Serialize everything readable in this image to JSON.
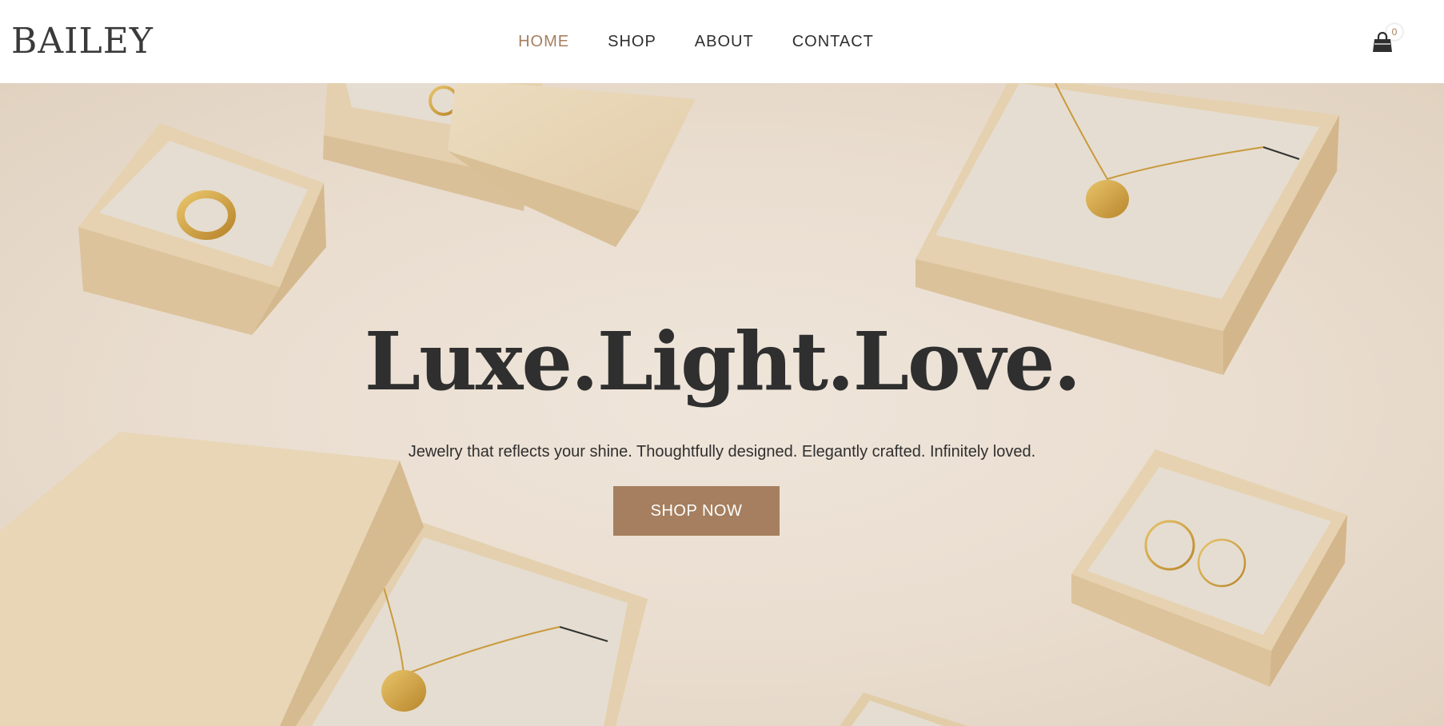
{
  "header": {
    "logo": "BAILEY",
    "nav": [
      {
        "label": "HOME",
        "active": true
      },
      {
        "label": "SHOP",
        "active": false
      },
      {
        "label": "ABOUT",
        "active": false
      },
      {
        "label": "CONTACT",
        "active": false
      }
    ],
    "cart_count": "0",
    "icons": {
      "cart": "shopping-bag-icon"
    }
  },
  "hero": {
    "title": "Luxe.Light.Love.",
    "subtitle": "Jewelry that reflects your shine. Thoughtfully designed. Elegantly crafted. Infinitely loved.",
    "cta_label": "SHOP NOW"
  },
  "colors": {
    "accent": "#a57f5f",
    "text": "#2f2f2f",
    "background": "#ffffff",
    "hero_background": "#ebe0d3",
    "box": "#e7d4b4",
    "gold": "#c99a3d"
  }
}
